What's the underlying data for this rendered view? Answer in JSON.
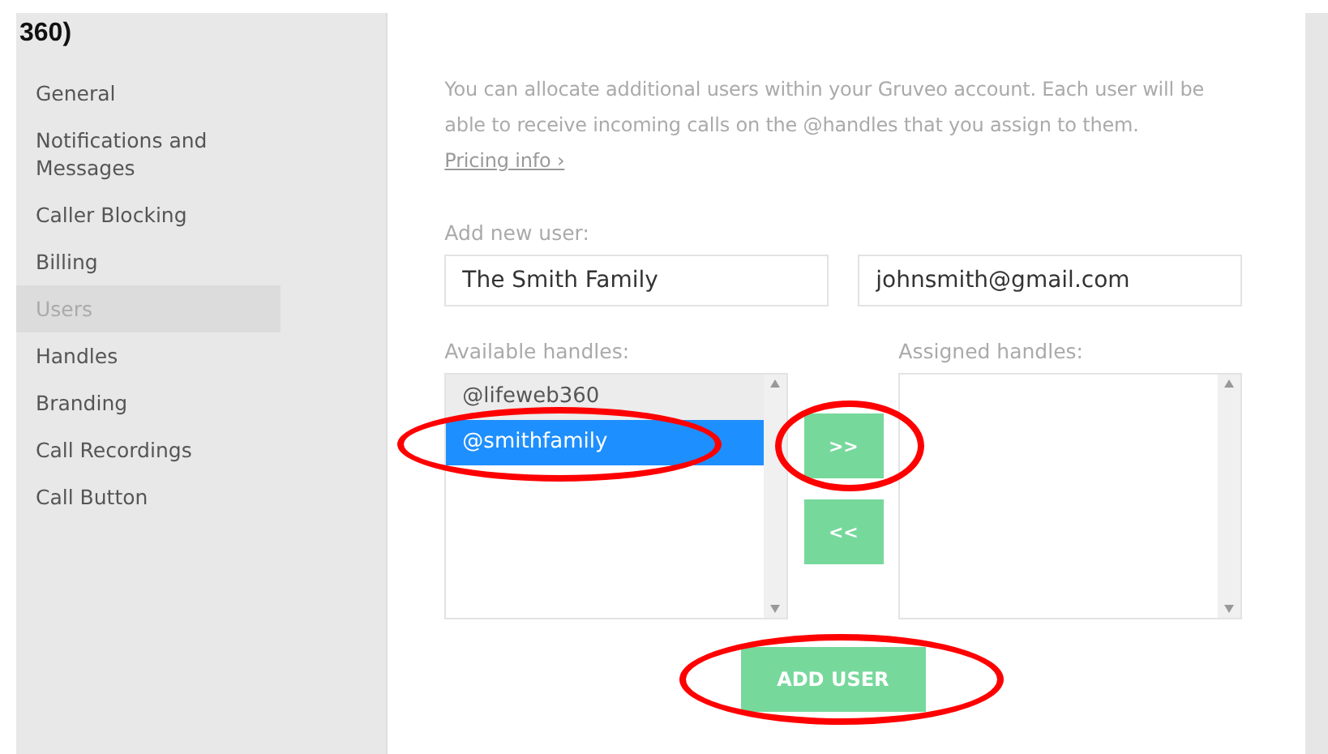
{
  "sidebar": {
    "heading": "360)",
    "items": [
      {
        "label": "General",
        "selected": false
      },
      {
        "label": "Notifications and Messages",
        "selected": false
      },
      {
        "label": "Caller Blocking",
        "selected": false
      },
      {
        "label": "Billing",
        "selected": false
      },
      {
        "label": "Users",
        "selected": true
      },
      {
        "label": "Handles",
        "selected": false
      },
      {
        "label": "Branding",
        "selected": false
      },
      {
        "label": "Call Recordings",
        "selected": false
      },
      {
        "label": "Call Button",
        "selected": false
      }
    ]
  },
  "intro": {
    "text": "You can allocate additional users within your Gruveo account. Each user will be able to receive incoming calls on the @handles that you assign to them.",
    "link": "Pricing info ›"
  },
  "new_user": {
    "label": "Add new user:",
    "name_value": "The Smith Family",
    "email_value": "johnsmith@gmail.com"
  },
  "available": {
    "label": "Available handles:",
    "items": [
      {
        "label": "@lifeweb360",
        "selected": false,
        "highlighted": true,
        "circled": false
      },
      {
        "label": "@smithfamily",
        "selected": true,
        "highlighted": false,
        "circled": true
      }
    ]
  },
  "assigned": {
    "label": "Assigned handles:"
  },
  "move_buttons": [
    {
      "label": ">>",
      "circled": true
    },
    {
      "label": "<<",
      "circled": false
    }
  ],
  "add_button": {
    "label": "ADD USER",
    "circled": true
  }
}
